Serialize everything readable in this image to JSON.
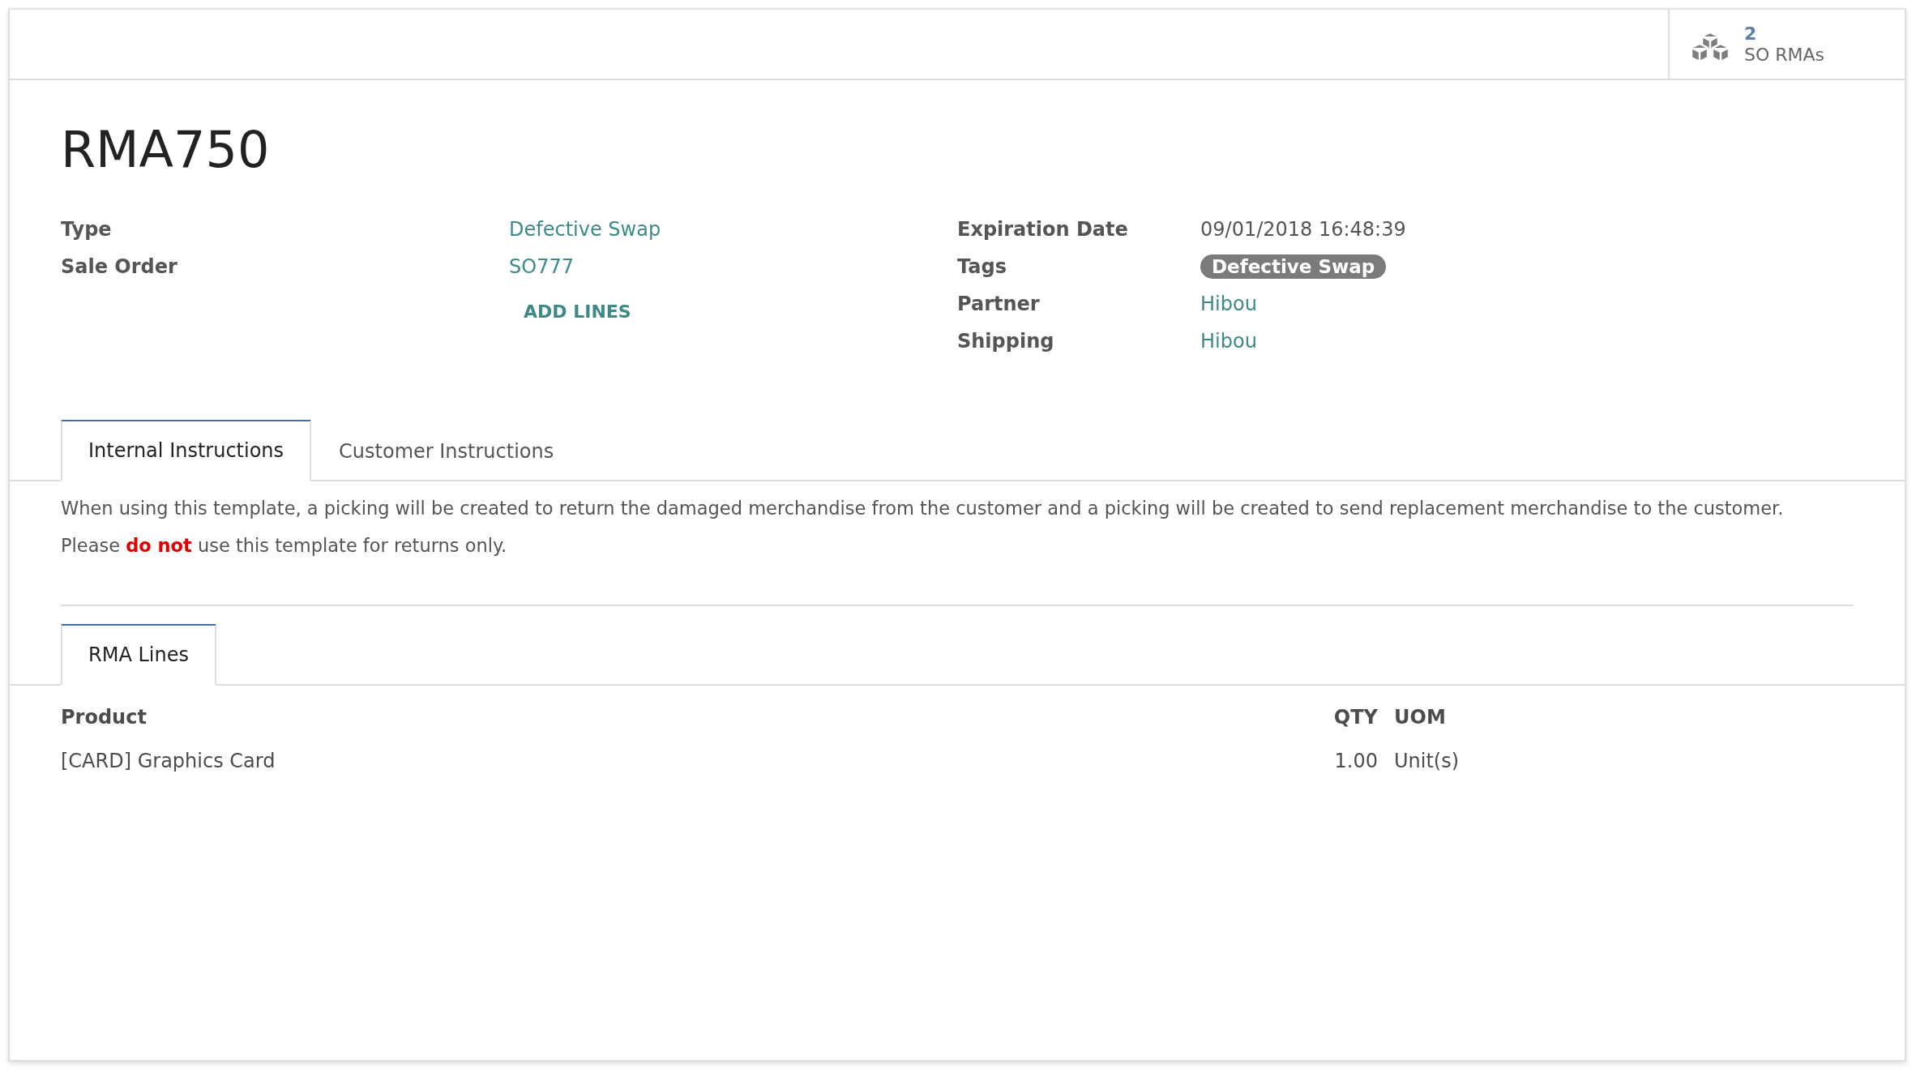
{
  "smart_button": {
    "count": "2",
    "label": "SO RMAs"
  },
  "title": "RMA750",
  "left_fields": [
    {
      "label": "Type",
      "value": "Defective Swap",
      "kind": "link"
    },
    {
      "label": "Sale Order",
      "value": "SO777",
      "kind": "link"
    }
  ],
  "add_lines_button": "ADD LINES",
  "right_fields": [
    {
      "label": "Expiration Date",
      "value": "09/01/2018 16:48:39",
      "kind": "text"
    },
    {
      "label": "Tags",
      "value": "Defective Swap",
      "kind": "tag"
    },
    {
      "label": "Partner",
      "value": "Hibou",
      "kind": "link"
    },
    {
      "label": "Shipping",
      "value": "Hibou",
      "kind": "link"
    }
  ],
  "tabs": [
    {
      "label": "Internal Instructions",
      "selected": true
    },
    {
      "label": "Customer Instructions",
      "selected": false
    }
  ],
  "instructions": [
    "When using this template, a picking will be created to return the damaged merchandise from the customer and a picking will be created to send replacement merchandise to the customer.",
    "Please **do not** use this template for returns only."
  ],
  "lines_tabs": [
    {
      "label": "RMA Lines",
      "selected": true
    }
  ],
  "lines_table": {
    "columns": [
      "Product",
      "QTY",
      "UOM"
    ],
    "rows": [
      [
        "[CARD] Graphics Card",
        "1.00",
        "Unit(s)"
      ]
    ]
  }
}
